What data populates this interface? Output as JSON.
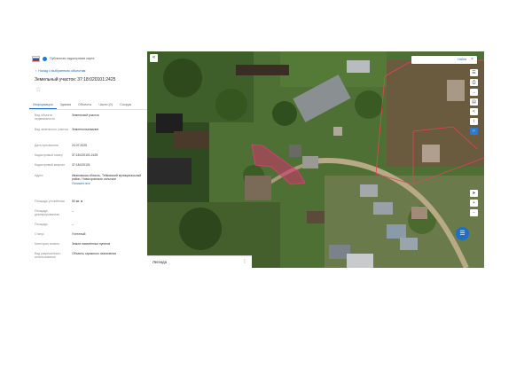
{
  "header": {
    "title": "Публичная кадастровая карта",
    "flag_icon": "russian-flag-icon",
    "logo_icon": "rosreestr-logo-icon"
  },
  "nav": {
    "back_label": "Назад к выбранным объектам"
  },
  "object": {
    "title": "Земельный участок: 37:18:020101:2425"
  },
  "tabs": [
    "Информация",
    "Здания",
    "Объекты",
    "Части (0)",
    "Сооруж"
  ],
  "active_tab": 0,
  "fields": [
    {
      "label": "Вид объекта недвижимости",
      "value": "Земельный участок"
    },
    {
      "label": "Вид земельного участка",
      "value": "Землепользование"
    },
    {
      "label": "Дата присвоения",
      "value": "24.07.2025"
    },
    {
      "label": "Кадастровый номер",
      "value": "37:18:020101:2425"
    },
    {
      "label": "Кадастровый квартал",
      "value": "37:18:020101"
    },
    {
      "label": "Адрес",
      "value": "Ивановская область, Тейковский муниципальный район, Новогоранское сельское",
      "link": "Показать все"
    },
    {
      "label": "Площадь уточнённая",
      "value": "50 кв. м"
    },
    {
      "label": "Площадь декларированная",
      "value": "–"
    },
    {
      "label": "Площадь",
      "value": "–"
    },
    {
      "label": "Статус",
      "value": "Учтенный"
    },
    {
      "label": "Категория земель",
      "value": "Земли населённых пунктов"
    },
    {
      "label": "Вид разрешенного использования",
      "value": "Объекты гаражного назначения"
    }
  ],
  "map": {
    "search_placeholder": "",
    "search_label": "Найти",
    "legend_title": "Легенда",
    "parcel_color": "#d4336e",
    "boundary_color": "#e8435a",
    "tools": [
      "layers-icon",
      "print-icon",
      "measure-icon",
      "ruler-icon",
      "share-icon",
      "info-icon",
      "pointer-icon"
    ],
    "zoom_tools": [
      "locate-icon",
      "zoom-in-icon",
      "zoom-out-icon"
    ]
  }
}
